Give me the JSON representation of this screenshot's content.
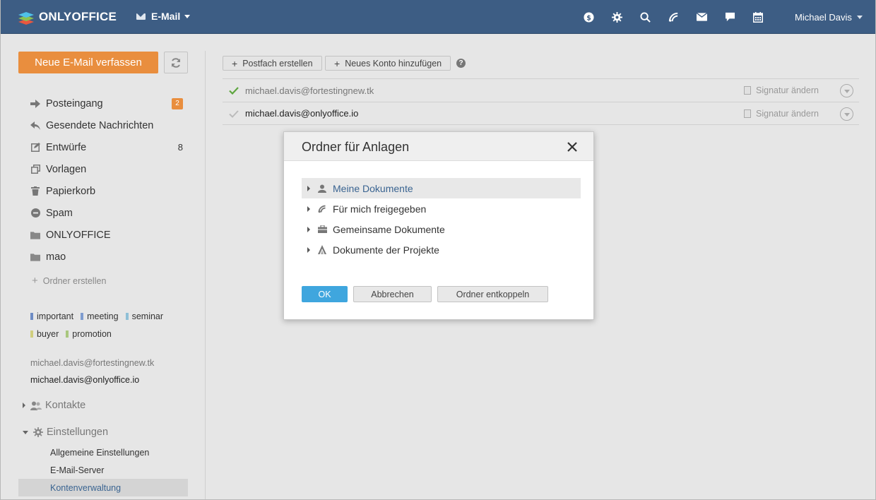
{
  "header": {
    "brand": "ONLYOFFICE",
    "module": "E-Mail",
    "user": "Michael Davis",
    "icons": [
      "billing-icon",
      "settings-icon",
      "search-icon",
      "feed-icon",
      "mail-icon",
      "chat-icon",
      "calendar-icon"
    ]
  },
  "sidebar": {
    "compose_label": "Neue E-Mail verfassen",
    "folders": [
      {
        "label": "Posteingang",
        "icon": "arrow-right-icon",
        "badge": "2"
      },
      {
        "label": "Gesendete Nachrichten",
        "icon": "reply-icon"
      },
      {
        "label": "Entwürfe",
        "icon": "draft-icon",
        "count": "8"
      },
      {
        "label": "Vorlagen",
        "icon": "templates-icon"
      },
      {
        "label": "Papierkorb",
        "icon": "trash-icon"
      },
      {
        "label": "Spam",
        "icon": "spam-icon"
      },
      {
        "label": "ONLYOFFICE",
        "icon": "folder-icon"
      },
      {
        "label": "mao",
        "icon": "folder-icon"
      }
    ],
    "create_folder_label": "Ordner erstellen",
    "tags": [
      {
        "label": "important",
        "color": "#6d8bc4"
      },
      {
        "label": "meeting",
        "color": "#7e9ccf"
      },
      {
        "label": "seminar",
        "color": "#8fc0d7"
      },
      {
        "label": "buyer",
        "color": "#d0ce7e"
      },
      {
        "label": "promotion",
        "color": "#a9c77e"
      }
    ],
    "accounts": [
      "michael.davis@fortestingnew.tk",
      "michael.davis@onlyoffice.io"
    ],
    "contacts_label": "Kontakte",
    "settings_label": "Einstellungen",
    "settings_items": [
      "Allgemeine Einstellungen",
      "E-Mail-Server",
      "Kontenverwaltung"
    ]
  },
  "main": {
    "create_mailbox_label": "Postfach erstellen",
    "add_account_label": "Neues Konto hinzufügen",
    "help_label": "?",
    "accounts": [
      {
        "email": "michael.davis@fortestingnew.tk",
        "signature_label": "Signatur ändern",
        "default": true
      },
      {
        "email": "michael.davis@onlyoffice.io",
        "signature_label": "Signatur ändern",
        "default": false
      }
    ]
  },
  "dialog": {
    "title": "Ordner für Anlagen",
    "tree": [
      {
        "label": "Meine Dokumente",
        "icon": "user-icon",
        "selected": true
      },
      {
        "label": "Für mich freigegeben",
        "icon": "shared-icon"
      },
      {
        "label": "Gemeinsame Dokumente",
        "icon": "briefcase-icon"
      },
      {
        "label": "Dokumente der Projekte",
        "icon": "projects-icon"
      }
    ],
    "ok_label": "OK",
    "cancel_label": "Abbrechen",
    "detach_label": "Ordner entkoppeln"
  },
  "colors": {
    "topbar": "#3d5d84",
    "accent_orange": "#e98e3e",
    "ok_blue": "#3fa6de",
    "link_blue": "#3a6491",
    "check_green": "#5ea63f"
  }
}
